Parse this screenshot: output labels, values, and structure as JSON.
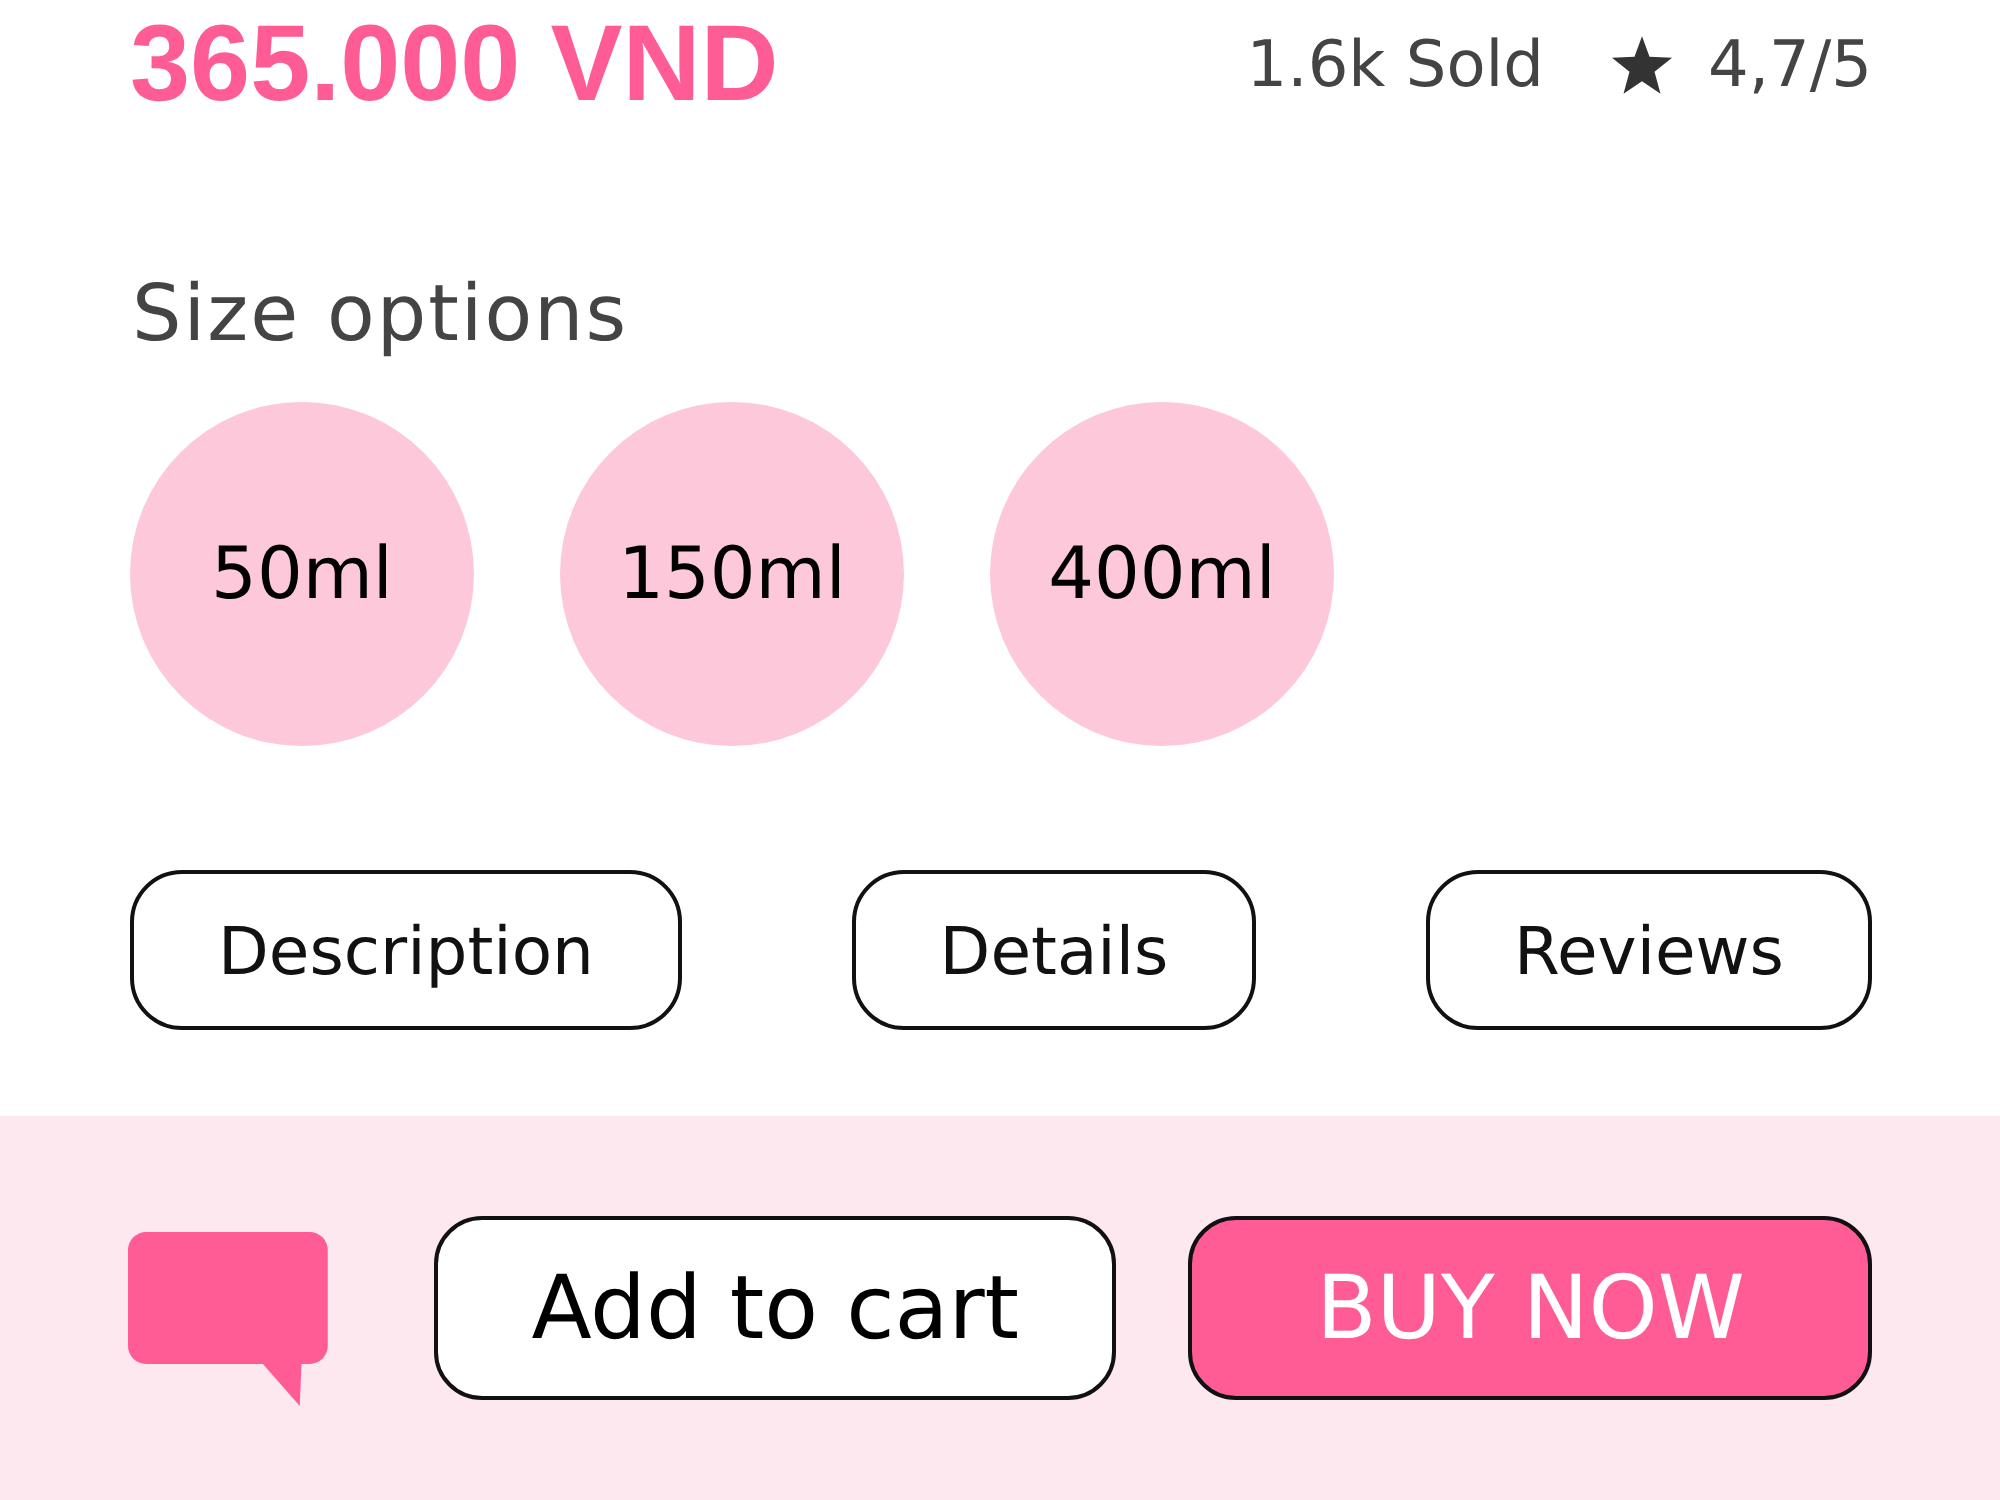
{
  "product": {
    "price": "365.000 VND",
    "sold": "1.6k Sold",
    "rating": "4,7/5"
  },
  "size_options": {
    "label": "Size options",
    "options": [
      {
        "label": "50ml"
      },
      {
        "label": "150ml"
      },
      {
        "label": "400ml"
      }
    ]
  },
  "tabs": [
    {
      "label": "Description"
    },
    {
      "label": "Details"
    },
    {
      "label": "Reviews"
    }
  ],
  "action_bar": {
    "buttons": [
      {
        "kind": "secondary",
        "label": "Add to cart"
      },
      {
        "kind": "primary",
        "label": "BUY NOW"
      }
    ]
  }
}
